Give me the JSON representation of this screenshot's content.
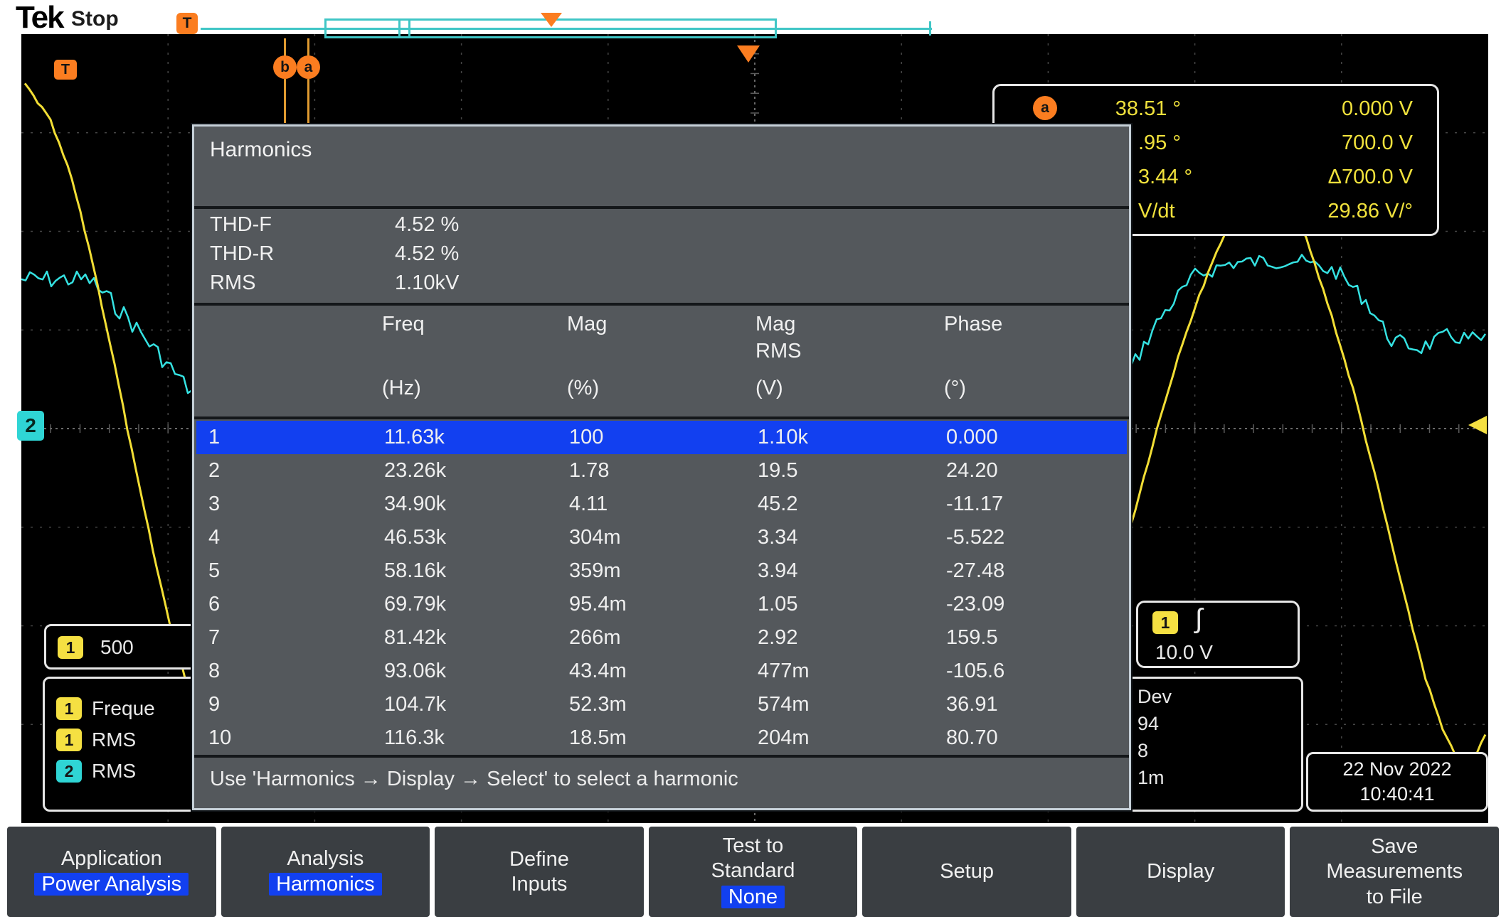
{
  "colors": {
    "accent_blue": "#1240f0",
    "ch1_yellow": "#f2de35",
    "ch2_cyan": "#35e2e2",
    "marker_orange": "#fb7d20"
  },
  "header": {
    "logo": "Tek",
    "status": "Stop"
  },
  "markers": {
    "topbar_trigger_tag": "T",
    "graticule_trigger_tag": "T",
    "cursor_b": "b",
    "cursor_a": "a",
    "ch2_badge": "2"
  },
  "cursor_readout": {
    "marker": "a",
    "rows": [
      {
        "label": "38.51 °",
        "value": "0.000 V"
      },
      {
        "label": ".95 °",
        "value": "700.0 V"
      },
      {
        "label": "3.44 °",
        "value": "Δ700.0 V"
      },
      {
        "label": "V/dt",
        "value": "29.86 V/°"
      }
    ]
  },
  "harmonics": {
    "title": "Harmonics",
    "summary": [
      {
        "label": "THD-F",
        "value": "4.52 %"
      },
      {
        "label": "THD-R",
        "value": "4.52 %"
      },
      {
        "label": "RMS",
        "value": "1.10kV"
      }
    ],
    "columns": {
      "freq_name": "Freq",
      "freq_unit": "(Hz)",
      "mag_name": "Mag",
      "mag_unit": "(%)",
      "mag_rms_name": "Mag",
      "mag_rms_name2": "RMS",
      "mag_rms_unit": "(V)",
      "phase_name": "Phase",
      "phase_unit": "(°)"
    },
    "selected_row": 0,
    "rows": [
      [
        "1",
        "11.63k",
        "100",
        "1.10k",
        "0.000"
      ],
      [
        "2",
        "23.26k",
        "1.78",
        "19.5",
        "24.20"
      ],
      [
        "3",
        "34.90k",
        "4.11",
        "45.2",
        "-11.17"
      ],
      [
        "4",
        "46.53k",
        "304m",
        "3.34",
        "-5.522"
      ],
      [
        "5",
        "58.16k",
        "359m",
        "3.94",
        "-27.48"
      ],
      [
        "6",
        "69.79k",
        "95.4m",
        "1.05",
        "-23.09"
      ],
      [
        "7",
        "81.42k",
        "266m",
        "2.92",
        "159.5"
      ],
      [
        "8",
        "93.06k",
        "43.4m",
        "477m",
        "-105.6"
      ],
      [
        "9",
        "104.7k",
        "52.3m",
        "574m",
        "36.91"
      ],
      [
        "10",
        "116.3k",
        "18.5m",
        "204m",
        "80.70"
      ]
    ],
    "footer": "Use 'Harmonics → Display → Select' to select a harmonic"
  },
  "trigger": {
    "channel": "1",
    "edge_symbol": "∫",
    "level": "10.0 V"
  },
  "channel_scale": {
    "channel": "1",
    "value": "500"
  },
  "measurements": {
    "items": [
      {
        "channel": "1",
        "label": "Freque"
      },
      {
        "channel": "1",
        "label": "RMS"
      },
      {
        "channel": "2",
        "label": "RMS"
      }
    ],
    "right_fragments": [
      "Dev",
      "94",
      "8",
      "1m"
    ]
  },
  "datetime": {
    "date": "22 Nov 2022",
    "time": "10:40:41"
  },
  "menu": [
    {
      "line1": "Application",
      "highlight": "Power Analysis"
    },
    {
      "line1": "Analysis",
      "highlight": "Harmonics"
    },
    {
      "line1": "Define",
      "line2": "Inputs"
    },
    {
      "line1": "Test to",
      "line2": "Standard",
      "highlight": "None"
    },
    {
      "line1": "Setup"
    },
    {
      "line1": "Display"
    },
    {
      "line1": "Save",
      "line2": "Measurements",
      "line3": "to File"
    }
  ]
}
